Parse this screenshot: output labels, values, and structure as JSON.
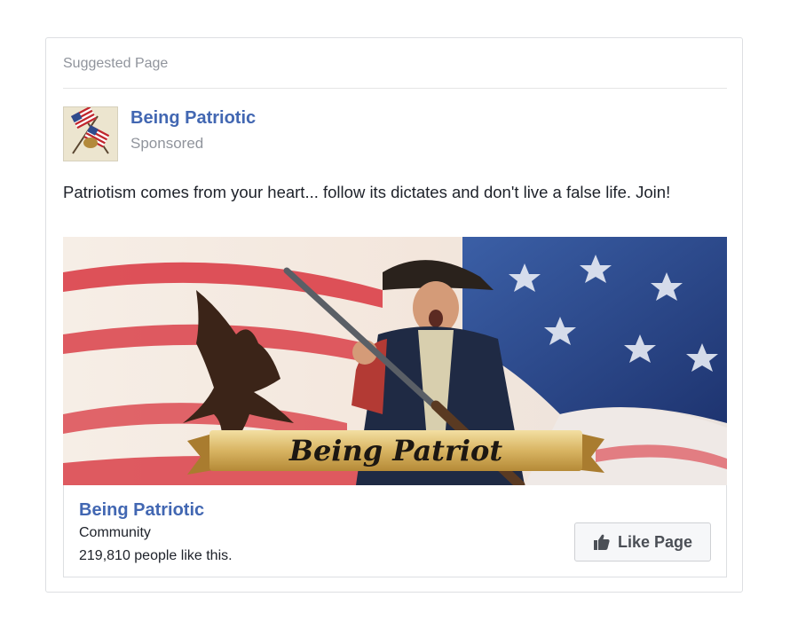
{
  "header": {
    "label": "Suggested Page"
  },
  "page": {
    "name": "Being Patriotic",
    "sponsored_label": "Sponsored",
    "thumbnail_icon": "crossed-flags-icon"
  },
  "post": {
    "text": "Patriotism comes from your heart... follow its dictates and don't live a false life. Join!"
  },
  "banner": {
    "ribbon_text": "Being Patriot"
  },
  "footer": {
    "page_name": "Being Patriotic",
    "category": "Community",
    "likes_text": "219,810 people like this.",
    "like_button_label": "Like Page",
    "like_icon": "thumbs-up-icon"
  },
  "colors": {
    "link_blue": "#4267b2",
    "muted_gray": "#90949c",
    "text_dark": "#1d2129",
    "button_bg": "#f6f7f9"
  }
}
